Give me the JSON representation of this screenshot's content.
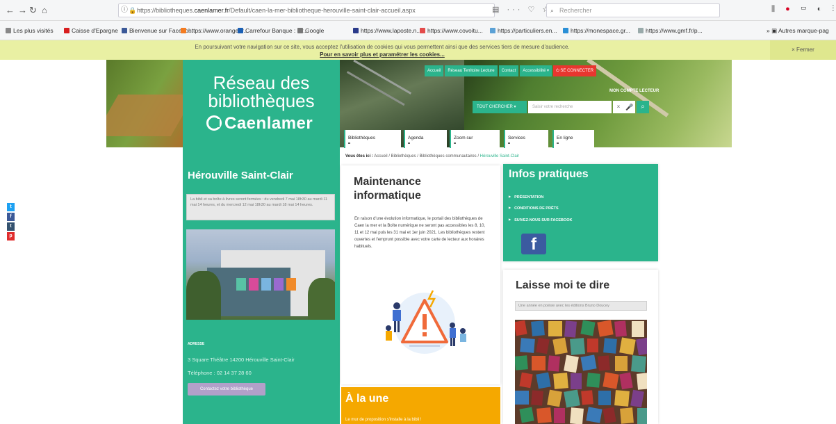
{
  "browser": {
    "url_prefix": "https://bibliotheques.",
    "url_domain": "caenlamer.fr",
    "url_rest": "/Default/caen-la-mer-bibliotheque-herouville-saint-clair-accueil.aspx",
    "search_placeholder": "Rechercher",
    "bookmarks": [
      {
        "label": "Les plus visités",
        "color": "#888888"
      },
      {
        "label": "Caisse d'Epargne",
        "color": "#d81e1e"
      },
      {
        "label": "Bienvenue sur Facebo...",
        "color": "#3b5998"
      },
      {
        "label": "https://www.orange.fr...",
        "color": "#f47b20"
      },
      {
        "label": "Carrefour Banque : Cr...",
        "color": "#1a5fb4"
      },
      {
        "label": "Google",
        "color": "#777777"
      },
      {
        "label": "https://www.laposte.n...",
        "color": "#2a3a8a"
      },
      {
        "label": "https://www.covoitu...",
        "color": "#e34a4a"
      },
      {
        "label": "https://particuliers.en...",
        "color": "#5ba1d6"
      },
      {
        "label": "https://monespace.gr...",
        "color": "#2a8fd6"
      },
      {
        "label": "https://www.gmf.fr/p...",
        "color": "#9aa"
      }
    ],
    "other_bookmarks": "Autres marque-pag"
  },
  "cookie": {
    "text": "En poursuivant votre navigation sur ce site, vous acceptez l'utilisation de cookies qui vous permettent ainsi que des services tiers de mesure d'audience.",
    "link": "Pour en savoir plus et paramétrer les cookies...",
    "close": "× Fermer"
  },
  "header": {
    "logo_line1": "Réseau des",
    "logo_line2": "bibliothèques",
    "logo_brand": "Caenlamer",
    "top_links": [
      "Accueil",
      "Réseau Territoire Lecture",
      "Contact",
      "Accessibilité"
    ],
    "login": "SE CONNECTER",
    "my_account": "MON COMPTE LECTEUR",
    "search_select": "TOUT CHERCHER",
    "search_placeholder": "Saisir votre recherche"
  },
  "main_nav": [
    "Bibliothèques",
    "Agenda",
    "Zoom sur",
    "Services",
    "En ligne"
  ],
  "breadcrumb": {
    "label": "Vous êtes ici :",
    "path": "Accueil / Bibliothèques / Bibliothèques communautaires /",
    "current": "Hérouville Saint-Clair"
  },
  "sidebar": {
    "title": "Hérouville Saint-Clair",
    "alert": "La bibli et sa boîte à livres seront fermées : du vendredi 7 mai 18h30 au mardi 11 mai 14 heures, et du mercredi 12 mai 18h30 au mardi 18 mai 14 heures.",
    "address_label": "ADRESSE",
    "address": "3 Square Théâtre 14200 Hérouville Saint-Clair",
    "tel": "Téléphone : 02 14 37 28 60",
    "contact_button": "Contactez votre bibliothèque"
  },
  "article": {
    "title_line1": "Maintenance",
    "title_line2": "informatique",
    "body": "En raison d'une évolution informatique, le portail des bibliothèques de Caen la mer et la Boîte numérique ne seront pas accessibles les 8, 10, 11 et 12 mai puis les 31 mai et 1er juin 2021. Les bibliothèques restent ouvertes et l'emprunt possible avec votre carte de lecteur aux horaires habituels."
  },
  "une": {
    "title": "À la une",
    "sub": "Le mur de proposition s'installe à la bibli !"
  },
  "infos": {
    "title": "Infos pratiques",
    "links": [
      "PRÉSENTATION",
      "CONDITIONS DE PRÊTS",
      "SUIVEZ-NOUS SUR FACEBOOK"
    ]
  },
  "laisse": {
    "title": "Laisse moi te dire",
    "note": "Une année en poésie avec les éditions Bruno Doucey"
  },
  "colors": {
    "accent": "#2bb48c",
    "orange": "#f5a800",
    "login_red": "#e8362f"
  }
}
